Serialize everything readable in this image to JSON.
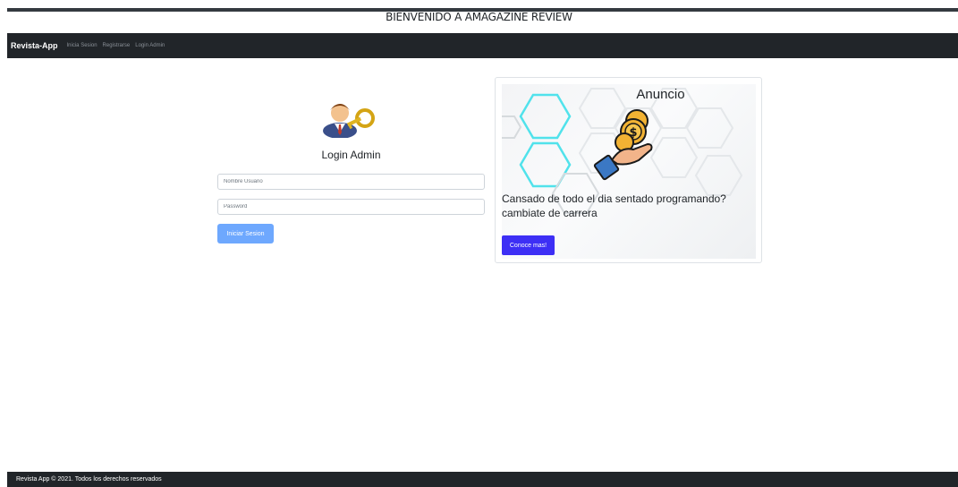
{
  "header": {
    "welcome": "BIENVENIDO A AMAGAZINE REVIEW"
  },
  "navbar": {
    "brand": "Revista-App",
    "links": [
      "Inicia Sesion",
      "Registrarse",
      "Login Admin"
    ]
  },
  "login": {
    "title": "Login Admin",
    "username_placeholder": "Nombre Usuario",
    "password_placeholder": "Password",
    "submit_label": "Iniciar Sesion"
  },
  "ad": {
    "title": "Anuncio",
    "text_line1": "Cansado de todo el dia sentado programando?",
    "text_line2": "cambiate de carrera",
    "button_label": "Conoce mas!",
    "button_color": "#3d2ff5"
  },
  "footer": {
    "text": "Revista App © 2021. Todos los derechos reservados"
  },
  "colors": {
    "navbar": "#212529",
    "login_button": "#6ea8fe",
    "accent_hexagon": "#3fe0ea",
    "coin": "#f2b233"
  }
}
